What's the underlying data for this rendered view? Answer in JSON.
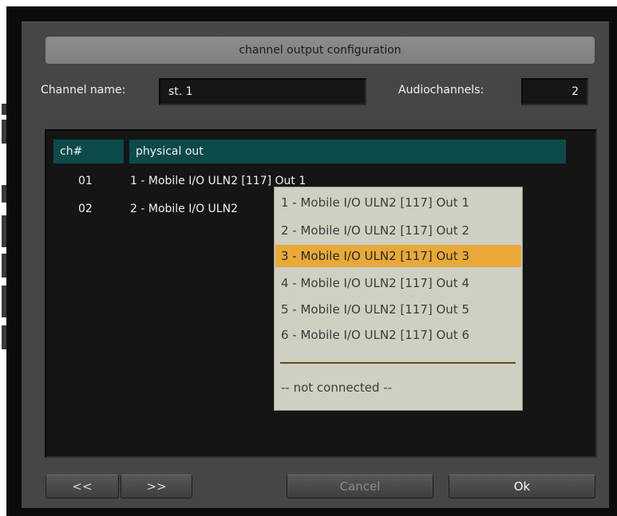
{
  "dialog": {
    "title": "channel output configuration",
    "channel_name_label": "Channel name:",
    "channel_name_value": "st. 1",
    "audiochannels_label": "Audiochannels:",
    "audiochannels_value": "2"
  },
  "table": {
    "headers": [
      "ch#",
      "physical out"
    ],
    "rows": [
      {
        "ch": "01",
        "out": "1 - Mobile I/O ULN2 [117] Out 1"
      },
      {
        "ch": "02",
        "out": "2 - Mobile I/O ULN2"
      }
    ]
  },
  "dropdown": {
    "options": [
      "1 - Mobile I/O ULN2 [117] Out 1",
      "2 - Mobile I/O ULN2 [117] Out 2",
      "3 - Mobile I/O ULN2 [117] Out 3",
      "4 - Mobile I/O ULN2 [117] Out 4",
      "5 - Mobile I/O ULN2 [117] Out 5",
      "6 - Mobile I/O ULN2 [117] Out 6"
    ],
    "selected_index": 2,
    "not_connected": "-- not connected --"
  },
  "buttons": {
    "prev": "<<",
    "next": ">>",
    "cancel": "Cancel",
    "ok": "Ok"
  },
  "colors": {
    "header_bg": "#0c4a4a",
    "selected_bg": "#e8a93a",
    "popup_bg": "#cfcfc2"
  }
}
